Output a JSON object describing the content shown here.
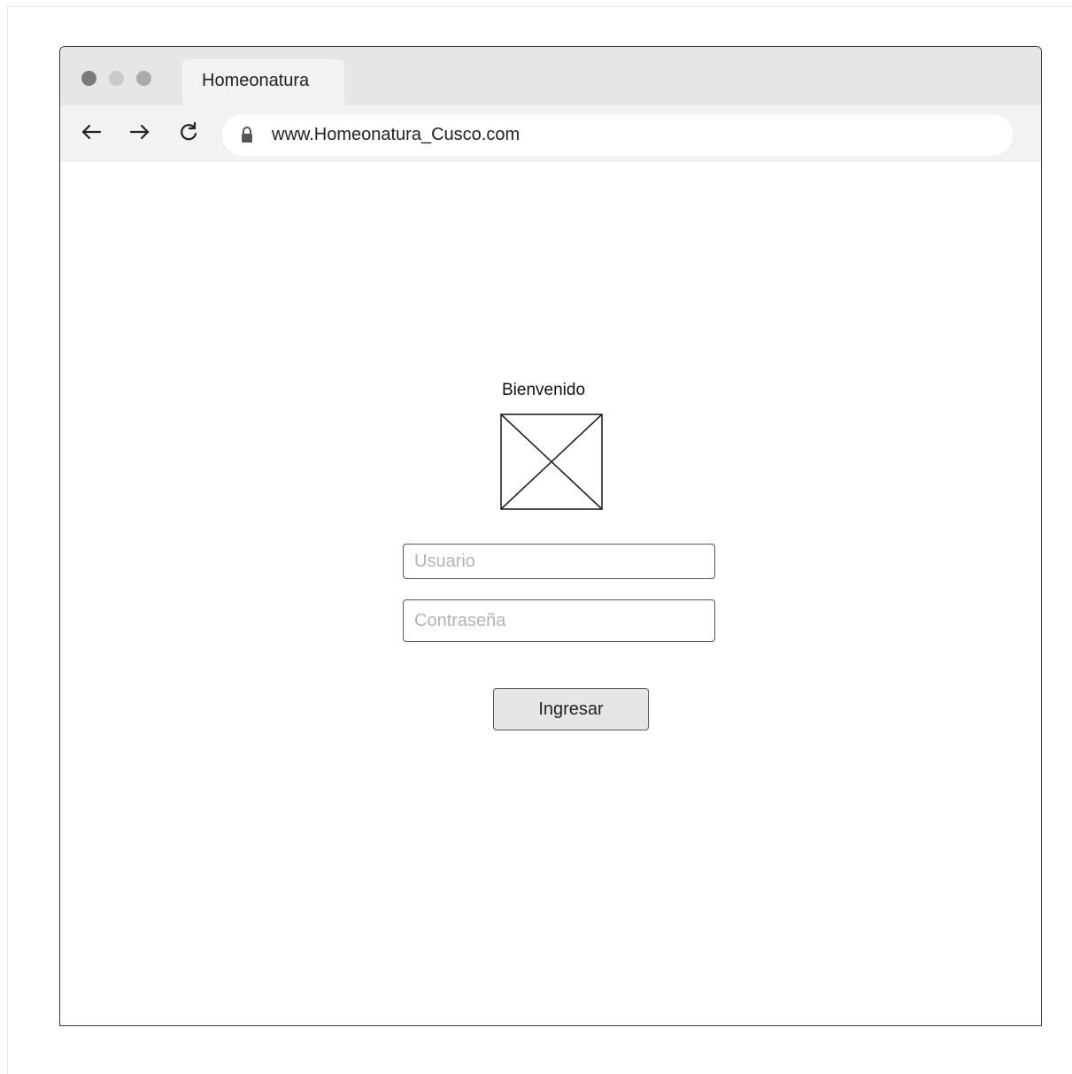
{
  "browser": {
    "tab_title": "Homeonatura",
    "url": "www.Homeonatura_Cusco.com"
  },
  "login": {
    "title": "Bienvenido",
    "username_placeholder": "Usuario",
    "password_placeholder": "Contraseña",
    "submit_label": "Ingresar"
  },
  "icons": {
    "window_dots": [
      "close-dot",
      "minimize-dot",
      "maximize-dot"
    ],
    "navigation": [
      "back-arrow-icon",
      "forward-arrow-icon",
      "reload-icon"
    ],
    "address": "lock-icon",
    "image": "image-placeholder-icon"
  },
  "colors": {
    "tab_strip": "#e6e6e6",
    "toolbar": "#f2f2f2",
    "button_fill": "#e6e6e6",
    "placeholder_text": "#b3b3b3"
  }
}
